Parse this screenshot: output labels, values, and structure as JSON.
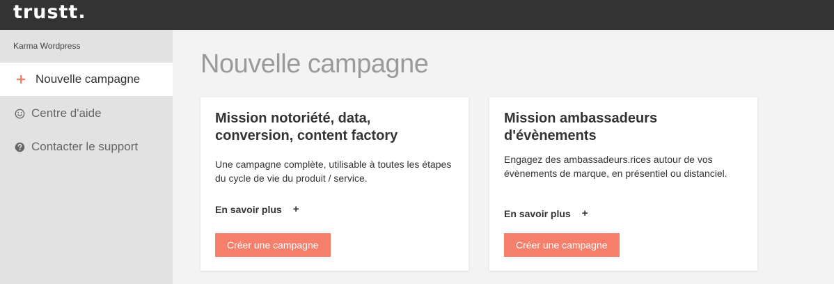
{
  "app": {
    "logo_text": "trustt."
  },
  "sidebar": {
    "account_name": "Karma Wordpress",
    "items": [
      {
        "label": "Nouvelle campagne",
        "icon": "plus-icon",
        "active": true
      },
      {
        "label": "Centre d'aide",
        "icon": "smiley-icon",
        "active": false
      },
      {
        "label": "Contacter le support",
        "icon": "question-circle-icon",
        "active": false
      }
    ]
  },
  "main": {
    "title": "Nouvelle campagne",
    "cards": [
      {
        "title": "Mission notoriété, data, conversion, content factory",
        "description": "Une campagne complète, utilisable à toutes les étapes du cycle de vie du produit / service.",
        "learn_more": "En savoir plus",
        "learn_more_icon": "+",
        "button_label": "Créer une campagne"
      },
      {
        "title": "Mission ambassadeurs d'évènements",
        "description": "Engagez des ambassadeurs.rices autour de vos évènements de marque, en présentiel ou distanciel.",
        "learn_more": "En savoir plus",
        "learn_more_icon": "+",
        "button_label": "Créer une campagne"
      }
    ]
  },
  "colors": {
    "topbar": "#333333",
    "sidebar": "#e2e2e2",
    "accent": "#f57f6a",
    "background": "#f3f3f3",
    "title_gray": "#9a9a9a"
  }
}
